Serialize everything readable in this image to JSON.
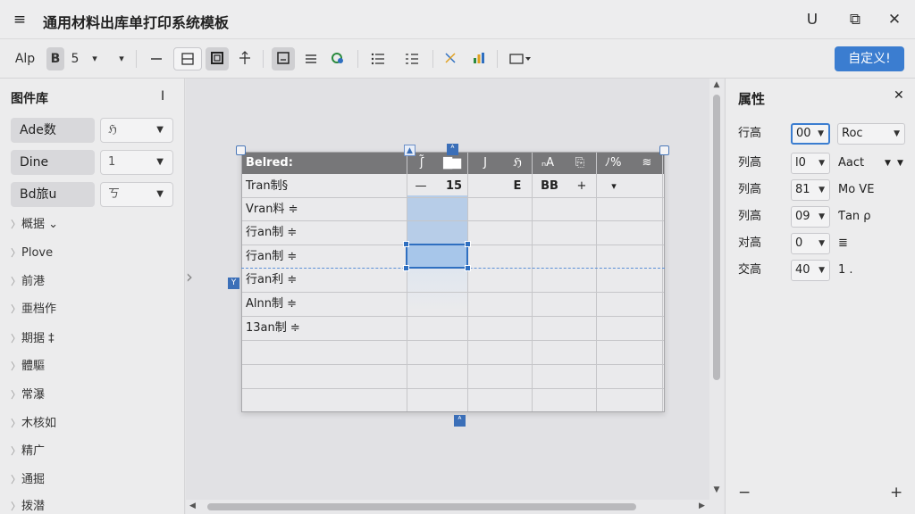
{
  "window": {
    "title": "通用材料出库单打印系统模板",
    "menu_icon": "≡",
    "min_icon": "ᑌ",
    "restore_icon": "⧉",
    "close_icon": "✕"
  },
  "toolbar": {
    "font_name": "Alp",
    "bold_label": "B",
    "font_size": "5",
    "dropdown_caret": "▾",
    "custom_button": "自定义!"
  },
  "left_panel": {
    "title": "图件库",
    "pin_icon": "I",
    "buttons": [
      {
        "label": "Ade数",
        "select": "ℌ"
      },
      {
        "label": "Dine",
        "select": "1"
      },
      {
        "label": "Bd旅u",
        "select": "ㄎ"
      }
    ],
    "items": [
      "概据 ⌄",
      "Plove",
      "前港",
      "亜档作",
      "期据 ‡",
      "體驅",
      "常瀑",
      "木核如",
      "精广",
      "通掘",
      "拨潜"
    ]
  },
  "grid": {
    "header": [
      "Belred:",
      "ʃ̃",
      "▇▆",
      "J",
      "ℌ",
      "ₙA",
      "⎘",
      "ﾉ%",
      "≋"
    ],
    "rows": [
      [
        "Tran制§",
        "—",
        "15",
        "",
        "E",
        "BB",
        "+",
        "▾",
        ""
      ],
      [
        "Vran料 ≑",
        "",
        "",
        "",
        "",
        "",
        "",
        "",
        ""
      ],
      [
        "行an制 ≑",
        "",
        "",
        "",
        "",
        "",
        "",
        "",
        ""
      ],
      [
        "行an制 ≑",
        "",
        "",
        "",
        "",
        "",
        "",
        "",
        ""
      ],
      [
        "行an利 ≑",
        "",
        "",
        "",
        "",
        "",
        "",
        "",
        ""
      ],
      [
        "Alnn制 ≑",
        "",
        "",
        "",
        "",
        "",
        "",
        "",
        ""
      ],
      [
        "13an制 ≑",
        "",
        "",
        "",
        "",
        "",
        "",
        "",
        ""
      ],
      [
        "",
        "",
        "",
        "",
        "",
        "",
        "",
        "",
        ""
      ],
      [
        "",
        "",
        "",
        "",
        "",
        "",
        "",
        "",
        ""
      ],
      [
        "",
        "",
        "",
        "",
        "",
        "",
        "",
        "",
        ""
      ]
    ],
    "row_marker": "Y"
  },
  "right_panel": {
    "title": "属性",
    "close_icon": "✕",
    "rows": [
      {
        "label": "行高",
        "num": "00",
        "extra": "Roc",
        "extra_type": "select"
      },
      {
        "label": "列高",
        "num": "l0",
        "extra": "Aact",
        "extra_type": "select"
      },
      {
        "label": "列高",
        "num": "81",
        "extra": "Mo  VE",
        "extra_type": "text"
      },
      {
        "label": "列高",
        "num": "09",
        "extra": "Ƭan ρ",
        "extra_type": "text"
      },
      {
        "label": "对高",
        "num": "0",
        "extra": "≣",
        "extra_type": "text"
      },
      {
        "label": "交高",
        "num": "40",
        "extra": "1 .",
        "extra_type": "text"
      }
    ],
    "minus_icon": "−",
    "plus_icon": "+"
  }
}
